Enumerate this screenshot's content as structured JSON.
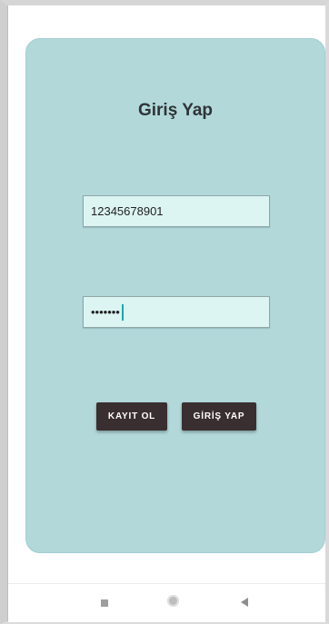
{
  "login": {
    "title": "Giriş Yap",
    "tc_value": "12345678901",
    "password_value": "•••••••",
    "register_button": "KAYIT OL",
    "login_button": "GİRİŞ YAP"
  },
  "colors": {
    "card_bg": "#b2d8da",
    "field_bg": "#dcf4f2",
    "button_bg": "#3a2f30",
    "caret": "#1aa8b0"
  },
  "nav": {
    "icons": [
      "recents-square-icon",
      "home-circle-icon",
      "back-triangle-icon"
    ]
  }
}
